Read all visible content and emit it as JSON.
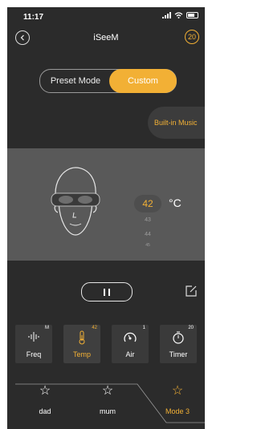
{
  "status": {
    "time": "11:17"
  },
  "header": {
    "title": "iSeeM",
    "timer_badge": "20",
    "back_icon": "back-circle-icon"
  },
  "mode_toggle": {
    "preset_label": "Preset Mode",
    "custom_label": "Custom",
    "selected": "custom"
  },
  "builtin_music": {
    "label": "Built-in Music"
  },
  "temperature": {
    "current": "42",
    "next": [
      "43",
      "44",
      "45"
    ],
    "unit": "°C"
  },
  "player": {
    "state": "paused"
  },
  "controls": [
    {
      "label": "Freq",
      "badge": "M",
      "icon": "waveform-icon",
      "active": false
    },
    {
      "label": "Temp",
      "badge": "42",
      "icon": "thermometer-icon",
      "active": true
    },
    {
      "label": "Air",
      "badge": "1",
      "icon": "air-pressure-icon",
      "active": false
    },
    {
      "label": "Timer",
      "badge": "20",
      "icon": "stopwatch-icon",
      "active": false
    }
  ],
  "profiles": [
    {
      "label": "dad",
      "icon": "star-icon",
      "selected": false
    },
    {
      "label": "mum",
      "icon": "star-icon",
      "selected": false
    },
    {
      "label": "Mode 3",
      "icon": "star-icon",
      "selected": true
    }
  ],
  "colors": {
    "accent": "#f2b035",
    "background": "#2b2b2b",
    "panel": "#595959"
  }
}
